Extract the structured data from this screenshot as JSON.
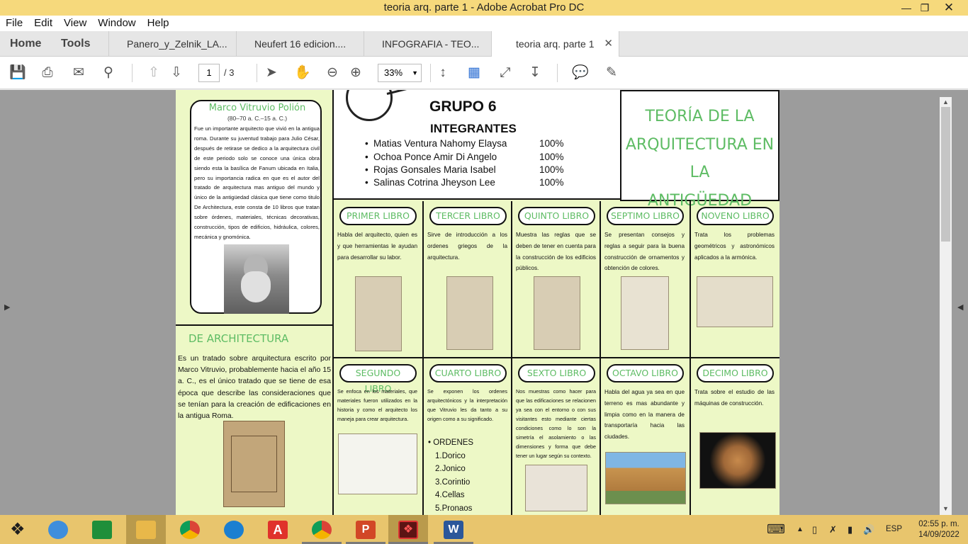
{
  "window": {
    "title": "teoria arq. parte 1 - Adobe Acrobat Pro DC"
  },
  "menu": [
    "File",
    "Edit",
    "View",
    "Window",
    "Help"
  ],
  "tabs": {
    "home": "Home",
    "tools": "Tools",
    "docs": [
      {
        "label": "Panero_y_Zelnik_LA..."
      },
      {
        "label": "Neufert 16 edicion...."
      },
      {
        "label": "INFOGRAFIA - TEO..."
      },
      {
        "label": "teoria arq. parte 1"
      }
    ]
  },
  "toolbar": {
    "page_current": "1",
    "page_total": "/ 3",
    "zoom": "33%"
  },
  "doc": {
    "vitruvio": {
      "name": "Marco Vitruvio Polión",
      "dates": "(80–70 a. C.–15 a. C.)",
      "text": "Fue un importante arquitecto que vivió en la antigua roma. Durante su juventud trabajo para Julio César, después de retirase se dedico a la arquitectura civil de este periodo solo se conoce una única obra siendo esta la basílica de Fanum ubicada en Italia, pero su importancia radica en que es el autor del tratado de arquitectura mas antiguo del mundo y único de la antigüedad clásica que tiene como titulo De Architectura, este consta de 10 libros que tratan sobre órdenes, materiales, técnicas decorativas, construcción, tipos de edificios, hidráulica, colores, mecánica y gnomónica."
    },
    "dearch": {
      "title": "DE ARCHITECTURA",
      "text": "Es un tratado sobre arquitectura escrito por Marco Vitruvio, probablemente hacia el año 15 a. C., es el único tratado que se tiene de esa época que describe las consideraciones que se tenían para la creación de edificaciones en la antigua Roma."
    },
    "group": {
      "title": "GRUPO 6",
      "subtitle": "INTEGRANTES",
      "members": [
        {
          "name": "Matias Ventura Nahomy Elaysa",
          "pct": "100%"
        },
        {
          "name": "Ochoa Ponce Amir Di Angelo",
          "pct": "100%"
        },
        {
          "name": "Rojas Gonsales Maria Isabel",
          "pct": "100%"
        },
        {
          "name": "Salinas Cotrina Jheyson Lee",
          "pct": "100%"
        }
      ]
    },
    "main_title": [
      "TEORÍA DE LA",
      "ARQUITECTURA EN LA",
      "ANTIGÜEDAD"
    ],
    "books": [
      {
        "title": "PRIMER LIBRO",
        "text": "Habla del arquitecto, quien es y que herramientas le ayudan para desarrollar su labor."
      },
      {
        "title": "TERCER LIBRO",
        "text": "Sirve de introducción a los ordenes griegos de la arquitectura."
      },
      {
        "title": "QUINTO LIBRO",
        "text": "Muestra las reglas que se deben de tener en cuenta para la construcción de los edificios públicos."
      },
      {
        "title": "SEPTIMO LIBRO",
        "text": "Se presentan consejos y reglas a seguir para la buena construcción de ornamentos y obtención de colores."
      },
      {
        "title": "NOVENO LIBRO",
        "text": "Trata los problemas geométricos y astronómicos aplicados a la armónica."
      },
      {
        "title": "SEGUNDO LIBRO",
        "text": "Se enfoca en los materiales, que materiales fueron utilizados en la historia y como el arquitecto los maneja para crear arquitectura."
      },
      {
        "title": "CUARTO LIBRO",
        "text": "Se exponen los ordenes arquitectónicos y la interpretación que Vitruvio les da tanto a su origen como a su significado."
      },
      {
        "title": "SEXTO LIBRO",
        "text": "Nos muestras como hacer para que las edificaciones se relacionen ya sea con el entorno o con sus visitantes esto mediante ciertas condiciones como lo son la simetría el asolamiento o las dimensiones y forma que debe tener un lugar según su contexto."
      },
      {
        "title": "OCTAVO LIBRO",
        "text": "Habla del agua ya sea en que terreno es mas abundante y limpia como en la manera de transportaría hacia las ciudades."
      },
      {
        "title": "DECIMO LIBRO",
        "text": "Trata sobre el estudio de las máquinas de construcción."
      }
    ],
    "orders": {
      "heading": "ORDENES",
      "items": [
        "1.Dorico",
        "2.Jonico",
        "3.Corintio",
        "4.Cellas",
        "5.Pronaos"
      ]
    }
  },
  "taskbar": {
    "lang": "ESP",
    "time": "02:55 p. m.",
    "date": "14/09/2022"
  }
}
